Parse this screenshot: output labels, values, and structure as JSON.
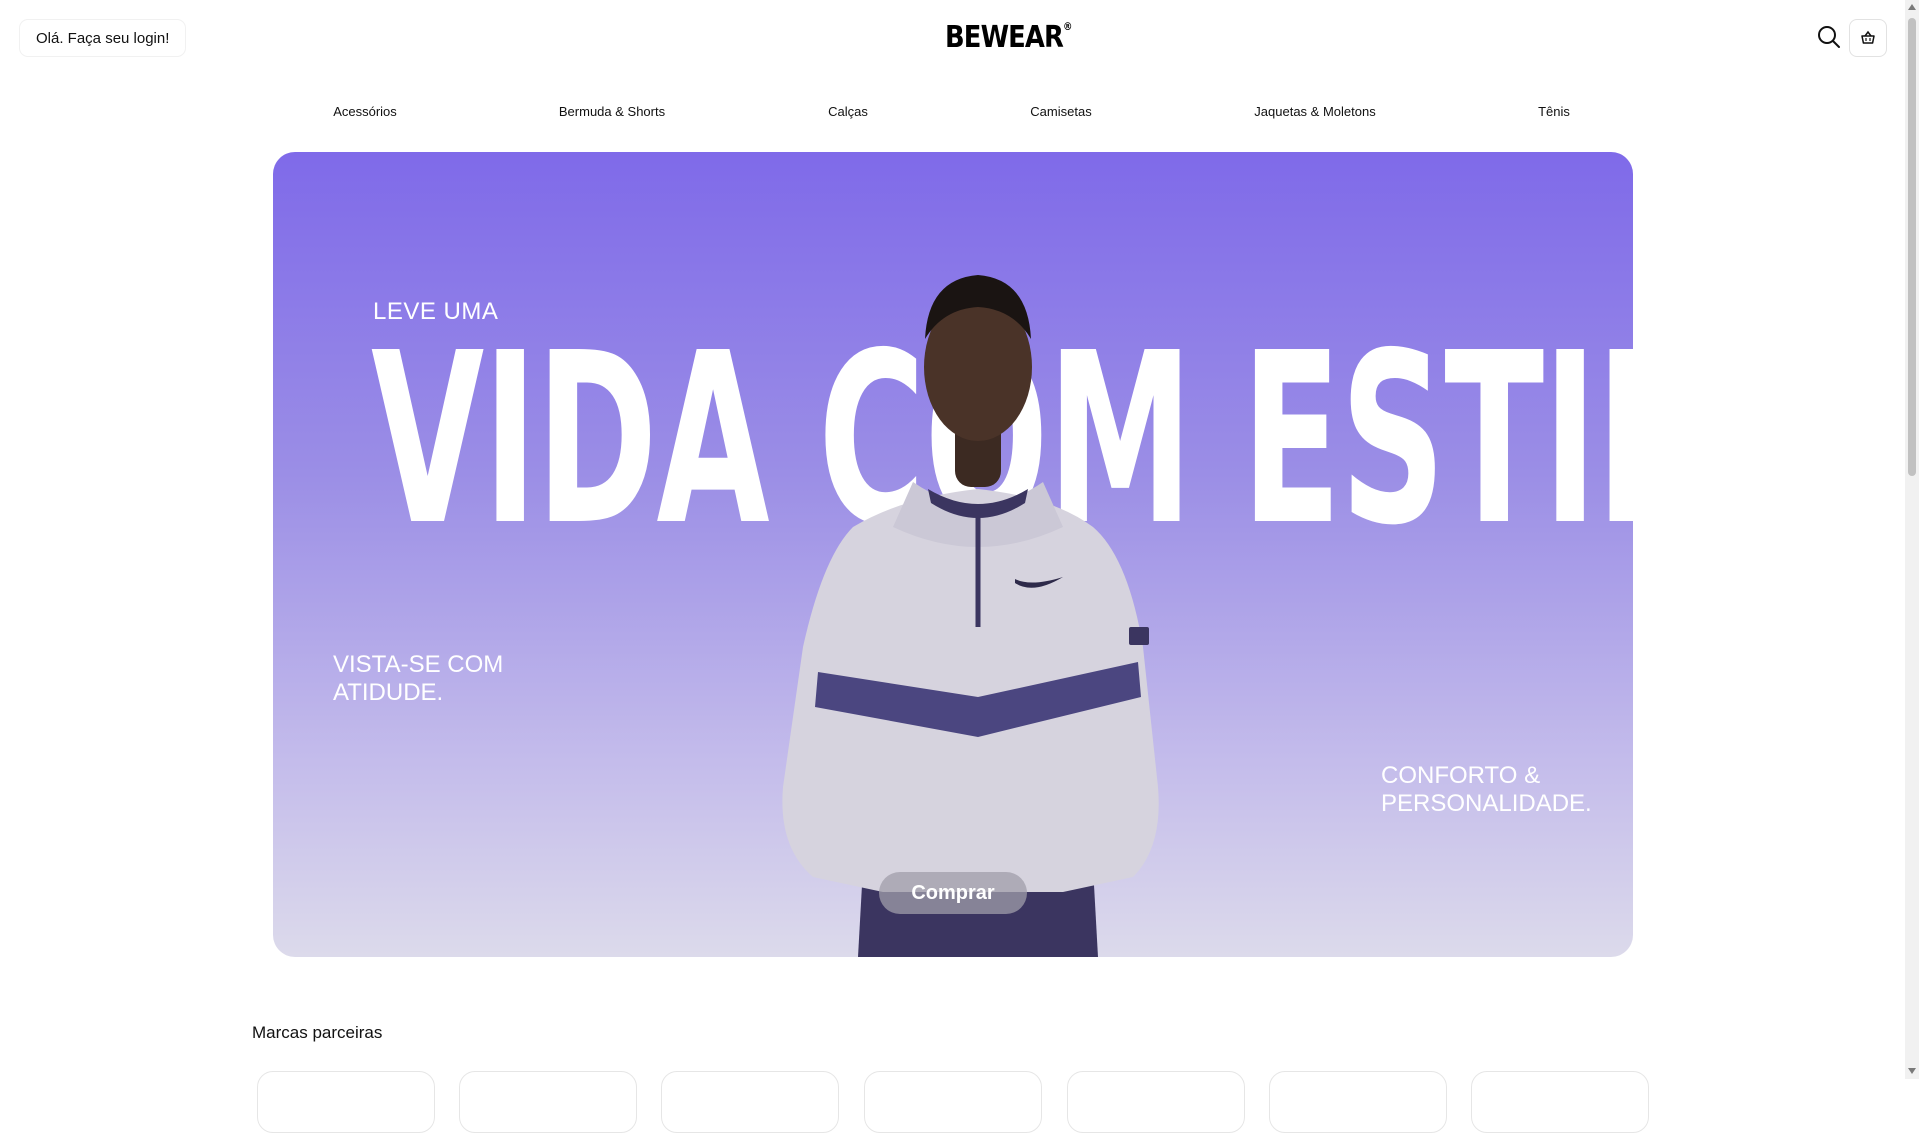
{
  "header": {
    "login_label": "Olá. Faça seu login!",
    "logo": "BEWEAR",
    "logo_mark": "®",
    "icons": {
      "search": "search-icon",
      "cart": "basket-icon"
    }
  },
  "nav": {
    "items": [
      {
        "label": "Acessórios"
      },
      {
        "label": "Bermuda & Shorts"
      },
      {
        "label": "Calças"
      },
      {
        "label": "Camisetas"
      },
      {
        "label": "Jaquetas & Moletons"
      },
      {
        "label": "Tênis"
      }
    ]
  },
  "hero": {
    "kicker": "LEVE UMA",
    "headline": "VIDA COM ESTILO",
    "left_tagline": "VISTA-SE COM ATIDUDE.",
    "right_tagline": "CONFORTO & PERSONALIDADE.",
    "cta_label": "Comprar",
    "colors": {
      "gradient_top": "#7f6ae9",
      "gradient_bottom": "#dcdaeb"
    }
  },
  "partners": {
    "title": "Marcas parceiras",
    "cards": [
      "",
      "",
      "",
      "",
      "",
      "",
      "",
      ""
    ]
  }
}
